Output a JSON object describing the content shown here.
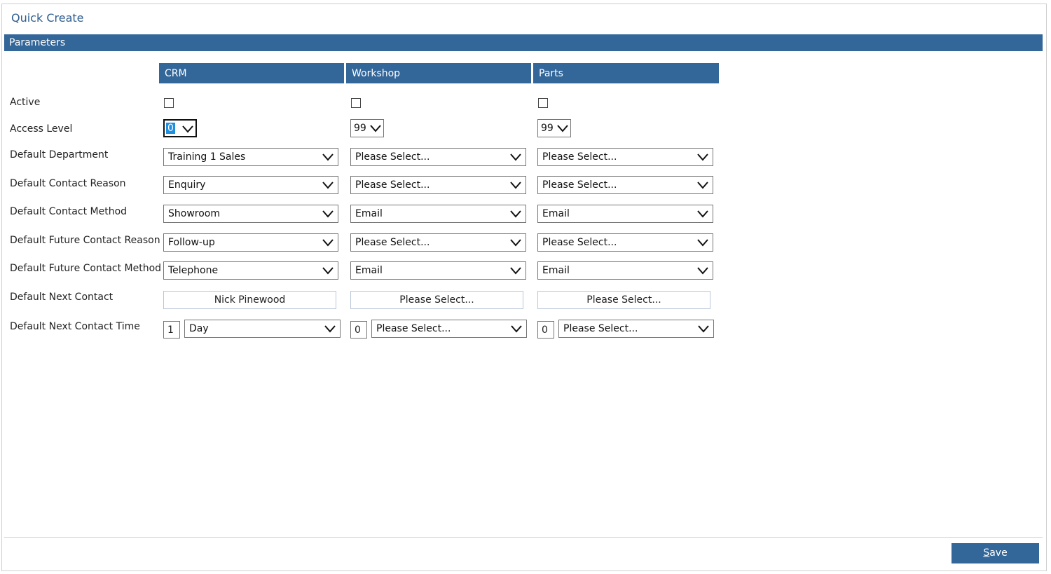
{
  "header": {
    "title": "Quick Create"
  },
  "section": {
    "title": "Parameters"
  },
  "columns": [
    "CRM",
    "Workshop",
    "Parts"
  ],
  "rows": {
    "active": "Active",
    "access_level": "Access Level",
    "default_department": "Default Department",
    "default_contact_reason": "Default Contact Reason",
    "default_contact_method": "Default Contact Method",
    "default_future_contact_reason": "Default Future Contact Reason",
    "default_future_contact_method": "Default Future Contact Method",
    "default_next_contact": "Default Next Contact",
    "default_next_contact_time": "Default Next Contact Time"
  },
  "values": {
    "crm": {
      "active": false,
      "access_level": "0",
      "department": "Training 1 Sales",
      "contact_reason": "Enquiry",
      "contact_method": "Showroom",
      "future_contact_reason": "Follow-up",
      "future_contact_method": "Telephone",
      "next_contact": "Nick Pinewood",
      "next_time_qty": "1",
      "next_time_unit": "Day"
    },
    "workshop": {
      "active": false,
      "access_level": "99",
      "department": "Please Select...",
      "contact_reason": "Please Select...",
      "contact_method": "Email",
      "future_contact_reason": "Please Select...",
      "future_contact_method": "Email",
      "next_contact": "Please Select...",
      "next_time_qty": "0",
      "next_time_unit": "Please Select..."
    },
    "parts": {
      "active": false,
      "access_level": "99",
      "department": "Please Select...",
      "contact_reason": "Please Select...",
      "contact_method": "Email",
      "future_contact_reason": "Please Select...",
      "future_contact_method": "Email",
      "next_contact": "Please Select...",
      "next_time_qty": "0",
      "next_time_unit": "Please Select..."
    }
  },
  "footer": {
    "save_label": "Save"
  },
  "colors": {
    "accent": "#336699",
    "title": "#2e5e8f"
  }
}
